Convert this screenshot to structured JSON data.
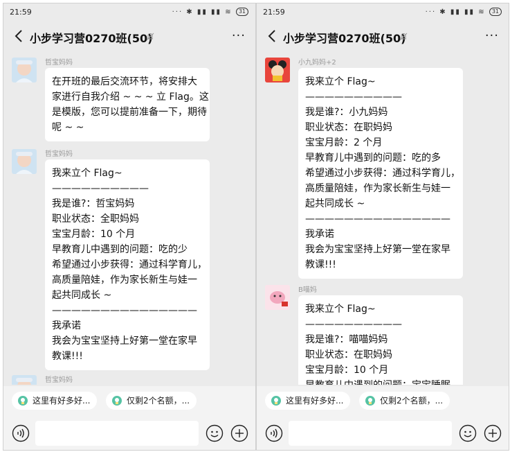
{
  "status_bar": {
    "time": "21:59",
    "indicators": "··· ✱ ▮▮ ▮▮ ≋",
    "battery": "31"
  },
  "group_title": "小步学习营0270班(50)",
  "left_screen": {
    "messages": [
      {
        "sender": "哲宝妈妈",
        "lines": [
          "在开班的最后交流环节，将安排大",
          "家进行自我介绍 ~ ~ ~ 立 Flag。这",
          "是模版，您可以提前准备一下，期待",
          "呢 ~ ~"
        ]
      },
      {
        "sender": "哲宝妈妈",
        "lines": [
          "我来立个 Flag~",
          "——————————",
          "我是谁?：哲宝妈妈",
          "职业状态：全职妈妈",
          "宝宝月龄：10 个月",
          "早教育儿中遇到的问题：吃的少",
          "希望通过小步获得：通过科学育儿，",
          "高质量陪娃，作为家长新生与娃一",
          "起共同成长 ~",
          "———————————————",
          "我承诺",
          "我会为宝宝坚持上好第一堂在家早",
          "教课!!!"
        ]
      },
      {
        "sender": "哲宝妈妈"
      }
    ]
  },
  "right_screen": {
    "messages": [
      {
        "sender": "小九妈妈+2",
        "lines": [
          "我来立个 Flag~",
          "——————————",
          "我是谁?：小九妈妈",
          "职业状态：在职妈妈",
          "宝宝月龄：2 个月",
          "早教育儿中遇到的问题：吃的多",
          "希望通过小步获得：通过科学育儿，",
          "高质量陪娃，作为家长新生与娃一",
          "起共同成长 ~",
          "———————————————",
          "我承诺",
          "我会为宝宝坚持上好第一堂在家早",
          "教课!!!"
        ]
      },
      {
        "sender": "B喵妈",
        "lines": [
          "我来立个 Flag~",
          "——————————",
          "我是谁?：喵喵妈妈",
          "职业状态：在职妈妈",
          "宝宝月龄：10 个月",
          "早教育儿中遇到的问题：宝宝睡眠"
        ]
      }
    ]
  },
  "quick_replies": [
    "这里有好多好...",
    "仅剩2个名额，..."
  ],
  "colors": {
    "background": "#ebebeb",
    "bubble": "#ffffff",
    "sender": "#9a9a9a",
    "chip_icon": "#56c3a4"
  },
  "icons": [
    "back-arrow-icon",
    "mute-bell-icon",
    "more-icon",
    "voice-icon",
    "emoji-icon",
    "plus-icon",
    "chip-badge-icon"
  ]
}
